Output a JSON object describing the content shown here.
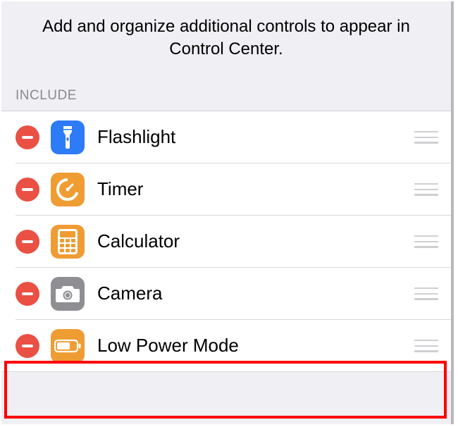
{
  "header": {
    "description": "Add and organize additional controls to appear in Control Center."
  },
  "section": {
    "title": "INCLUDE"
  },
  "items": [
    {
      "label": "Flashlight",
      "icon": "flashlight",
      "icon_bg": "blue"
    },
    {
      "label": "Timer",
      "icon": "timer",
      "icon_bg": "orange"
    },
    {
      "label": "Calculator",
      "icon": "calculator",
      "icon_bg": "orange"
    },
    {
      "label": "Camera",
      "icon": "camera",
      "icon_bg": "gray"
    },
    {
      "label": "Low Power Mode",
      "icon": "battery",
      "icon_bg": "orange"
    }
  ],
  "highlight_index": 4
}
